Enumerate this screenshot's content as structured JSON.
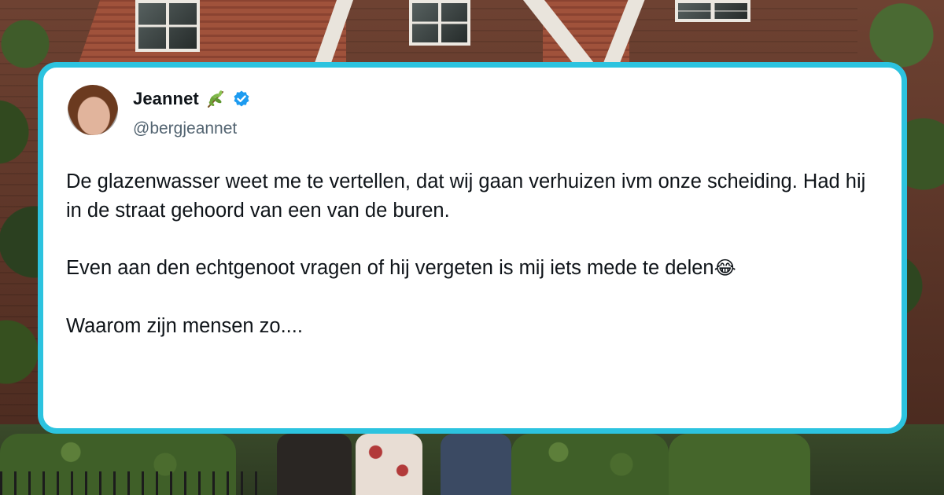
{
  "tweet": {
    "author": {
      "display_name": "Jeannet",
      "handle": "@bergjeannet",
      "name_emoji_icon": "herb-sprig-icon",
      "verified_icon": "verified-badge-icon"
    },
    "paragraphs": [
      "De glazenwasser weet me te vertellen, dat wij gaan verhuizen ivm onze scheiding. Had hij in de straat gehoord van een van de buren.",
      "Even aan den echtgenoot vragen of hij vergeten is mij iets mede te delen",
      "Waarom zijn mensen zo...."
    ],
    "paragraph_2_emoji": "😂"
  },
  "colors": {
    "card_border": "#2cc3df",
    "verified_badge": "#1d9bf0",
    "text_primary": "#0f1419",
    "text_secondary": "#536471"
  }
}
